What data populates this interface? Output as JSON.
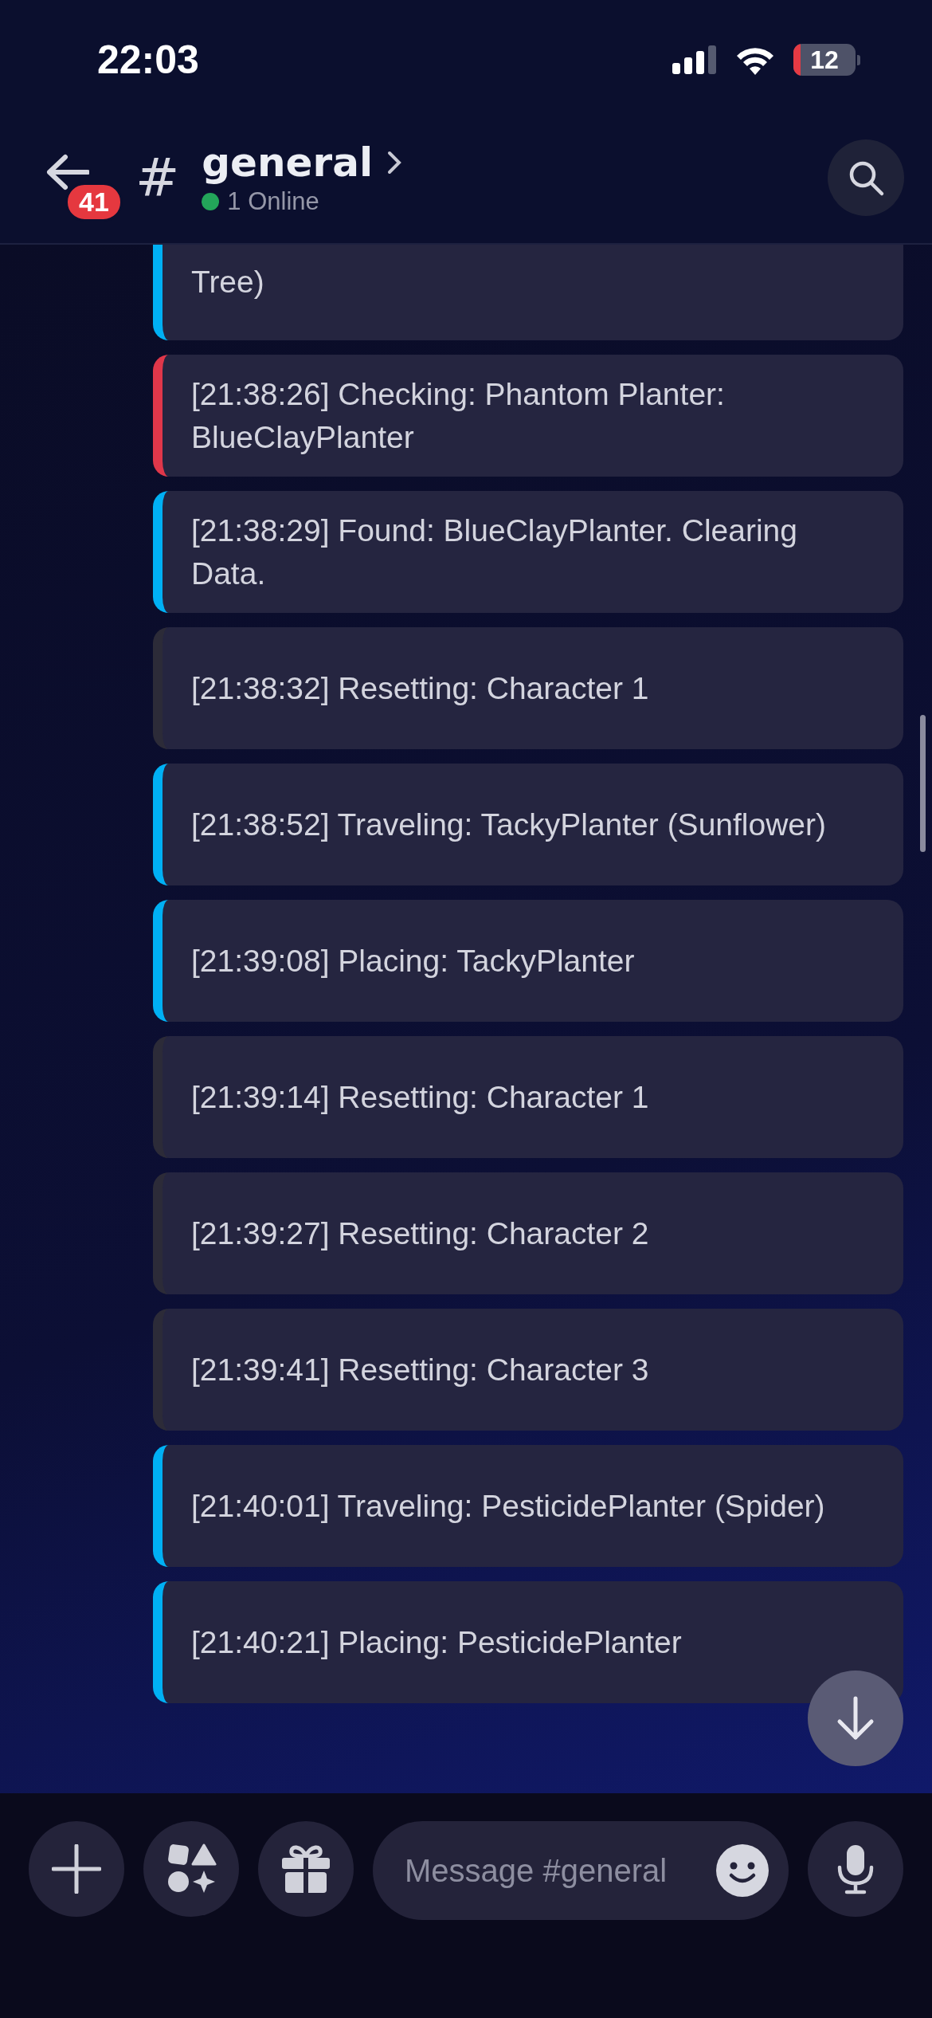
{
  "status_bar": {
    "time": "22:03",
    "battery": "12"
  },
  "header": {
    "back_badge": "41",
    "channel_symbol": "#",
    "channel": "general",
    "online_status": "1 Online"
  },
  "messages": [
    {
      "text": "Tree)",
      "color": "#00b0f4",
      "partial": true
    },
    {
      "text": "[21:38:26] Checking: Phantom Planter: BlueClayPlanter",
      "color": "#e0374a"
    },
    {
      "text": "[21:38:29] Found: BlueClayPlanter. Clearing Data.",
      "color": "#00b0f4"
    },
    {
      "text": "[21:38:32] Resetting: Character 1",
      "color": "#2c2b38"
    },
    {
      "text": "[21:38:52] Traveling: TackyPlanter (Sunflower)",
      "color": "#00b0f4"
    },
    {
      "text": "[21:39:08] Placing: TackyPlanter",
      "color": "#00b0f4"
    },
    {
      "text": "[21:39:14] Resetting: Character 1",
      "color": "#2c2b38"
    },
    {
      "text": "[21:39:27] Resetting: Character 2",
      "color": "#2c2b38"
    },
    {
      "text": "[21:39:41] Resetting: Character 3",
      "color": "#2c2b38"
    },
    {
      "text": "[21:40:01] Traveling: PesticidePlanter (Spider)",
      "color": "#00b0f4"
    },
    {
      "text": "[21:40:21] Placing: PesticidePlanter",
      "color": "#00b0f4"
    }
  ],
  "composer": {
    "placeholder": "Message #general"
  }
}
